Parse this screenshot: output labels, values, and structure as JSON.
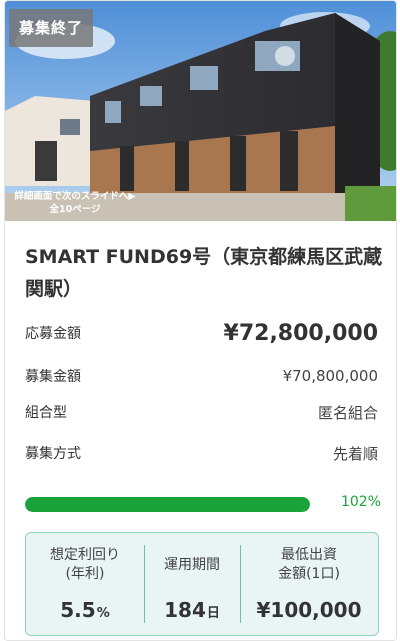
{
  "hero": {
    "status_badge": "募集終了",
    "slide_hint_line1": "詳細画面で次のスライドへ▶",
    "slide_hint_line2": "全10ページ"
  },
  "fund": {
    "title": "SMART FUND69号（東京都練馬区武蔵関駅）"
  },
  "info_rows": [
    {
      "label": "応募金額",
      "value": "¥72,800,000"
    },
    {
      "label": "募集金額",
      "value": "¥70,800,000"
    },
    {
      "label": "組合型",
      "value": "匿名組合"
    },
    {
      "label": "募集方式",
      "value": "先着順"
    }
  ],
  "progress": {
    "percent_label": "102%",
    "fill_fraction": 1.0,
    "color": "#1aa33a"
  },
  "stats": {
    "yield": {
      "label_line1": "想定利回り",
      "label_line2": "(年利)",
      "value": "5.5",
      "unit": "%"
    },
    "period": {
      "label": "運用期間",
      "value": "184",
      "unit": "日"
    },
    "minimum": {
      "label_line1": "最低出資",
      "label_line2": "金額(1口)",
      "value": "¥100,000"
    }
  }
}
